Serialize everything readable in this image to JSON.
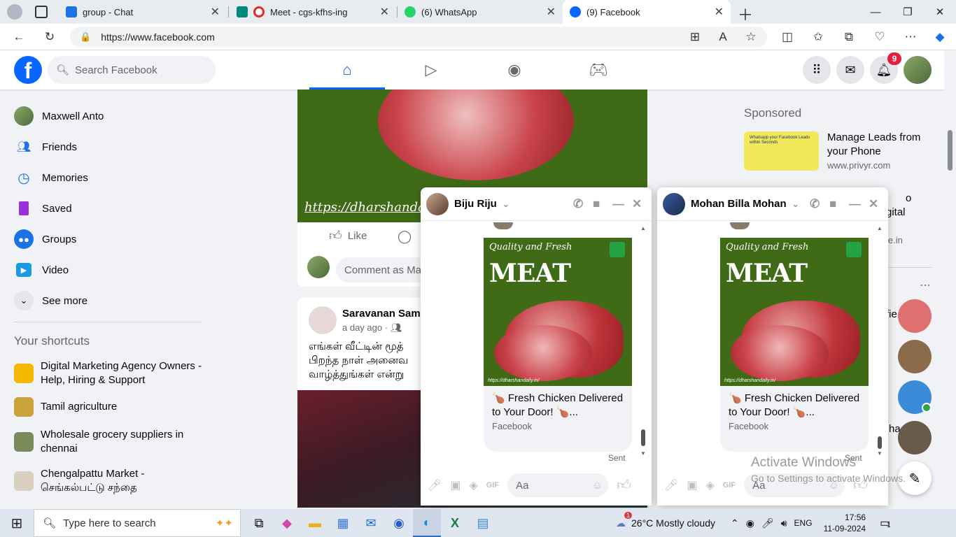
{
  "browser": {
    "tabs": [
      {
        "label": "group - Chat",
        "icon": "google-chat-icon",
        "color": "#1a73e8"
      },
      {
        "label": "Meet - cgs-kfhs-ing",
        "icon": "google-meet-icon",
        "color": "#00897b"
      },
      {
        "label": "(6) WhatsApp",
        "icon": "whatsapp-icon",
        "color": "#25d366"
      },
      {
        "label": "(9) Facebook",
        "icon": "facebook-icon",
        "color": "#0866ff"
      }
    ],
    "url": "https://www.facebook.com"
  },
  "header": {
    "search_placeholder": "Search Facebook",
    "notif_count": "9",
    "nav": [
      "home-icon",
      "watch-icon",
      "groups-icon",
      "gaming-icon"
    ]
  },
  "sidebar": {
    "items": [
      {
        "label": "Maxwell Anto",
        "icon": "profile-avatar"
      },
      {
        "label": "Friends",
        "icon": "friends-icon"
      },
      {
        "label": "Memories",
        "icon": "memories-icon"
      },
      {
        "label": "Saved",
        "icon": "saved-icon"
      },
      {
        "label": "Groups",
        "icon": "groups-icon"
      },
      {
        "label": "Video",
        "icon": "video-icon"
      },
      {
        "label": "See more",
        "icon": "chevron-down-icon"
      }
    ],
    "shortcuts_title": "Your shortcuts",
    "shortcuts": [
      {
        "label": "Digital Marketing Agency Owners - Help, Hiring & Support",
        "color": "#f5b800"
      },
      {
        "label": "Tamil agriculture",
        "color": "#c9a23a"
      },
      {
        "label": "Wholesale grocery suppliers in chennai",
        "color": "#7a8a5a"
      },
      {
        "label": "Chengalpattu Market - செங்கல்பட்டு சந்தை",
        "color": "#d9d0c0"
      }
    ]
  },
  "feed": {
    "post1": {
      "link_text": "https://dharshandaily",
      "like": "Like",
      "comment_placeholder": "Comment as Ma"
    },
    "post2": {
      "author": "Saravanan Samik",
      "time": "a day ago ·",
      "text_lines": [
        "எங்கள் வீட்டின் மூத்",
        "பிறந்த நாள் அனைவ",
        "வாழ்த்துங்கள் என்று"
      ]
    }
  },
  "sponsored": {
    "title": "Sponsored",
    "ads": [
      {
        "headline": "Manage Leads from your Phone",
        "domain": "www.privyr.com",
        "image_text": "Whatsapp your Facebook Leads within Seconds"
      },
      {
        "headline_partial": "o",
        "headline_partial2": "gital",
        "domain_partial": "le.in"
      }
    ],
    "contacts_partial": [
      "fie",
      "ha"
    ]
  },
  "chats": [
    {
      "name": "Biju Riju",
      "card_title": "🍗 Fresh Chicken Delivered to Your Door! 🍗...",
      "card_source": "Facebook",
      "image_heading": "MEAT",
      "image_sub": "Quality and Fresh",
      "image_url_text": "https://dharshandaily.in/",
      "status": "Sent",
      "input_placeholder": "Aa"
    },
    {
      "name": "Mohan Billa Mohan",
      "card_title": "🍗 Fresh Chicken Delivered to Your Door! 🍗...",
      "card_source": "Facebook",
      "image_heading": "MEAT",
      "image_sub": "Quality and Fresh",
      "image_url_text": "https://dharshandaily.in/",
      "status": "Sent",
      "input_placeholder": "Aa"
    }
  ],
  "watermark": {
    "line1": "Activate Windows",
    "line2": "Go to Settings to activate Windows."
  },
  "taskbar": {
    "search_placeholder": "Type here to search",
    "weather": "26°C  Mostly cloudy",
    "weather_badge": "1",
    "lang": "ENG",
    "time": "17:56",
    "date": "11-09-2024",
    "notif": "1"
  }
}
